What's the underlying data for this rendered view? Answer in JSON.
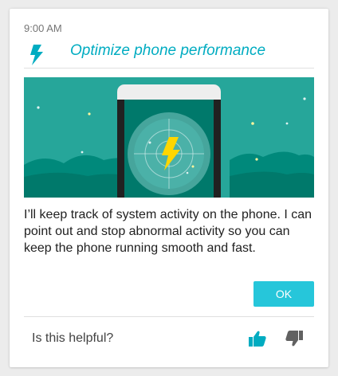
{
  "card": {
    "time": "9:00 AM",
    "title": "Optimize phone performance",
    "body": "I’ll keep track of system activity on the phone. I can point out and stop abnormal activity so you can keep the phone running smooth and fast.",
    "ok_label": "OK",
    "helpful_prompt": "Is this helpful?"
  },
  "icons": {
    "title_icon": "lightning-bolt-icon",
    "banner_icon": "lightning-bolt-icon",
    "thumbs_up": "thumbs-up-icon",
    "thumbs_down": "thumbs-down-icon"
  },
  "colors": {
    "accent": "#00acc1",
    "button": "#26c6da",
    "banner_bg": "#26a69a",
    "bolt_yellow": "#ffd600",
    "thumbs_up": "#00acc1",
    "thumbs_down": "#616161"
  }
}
